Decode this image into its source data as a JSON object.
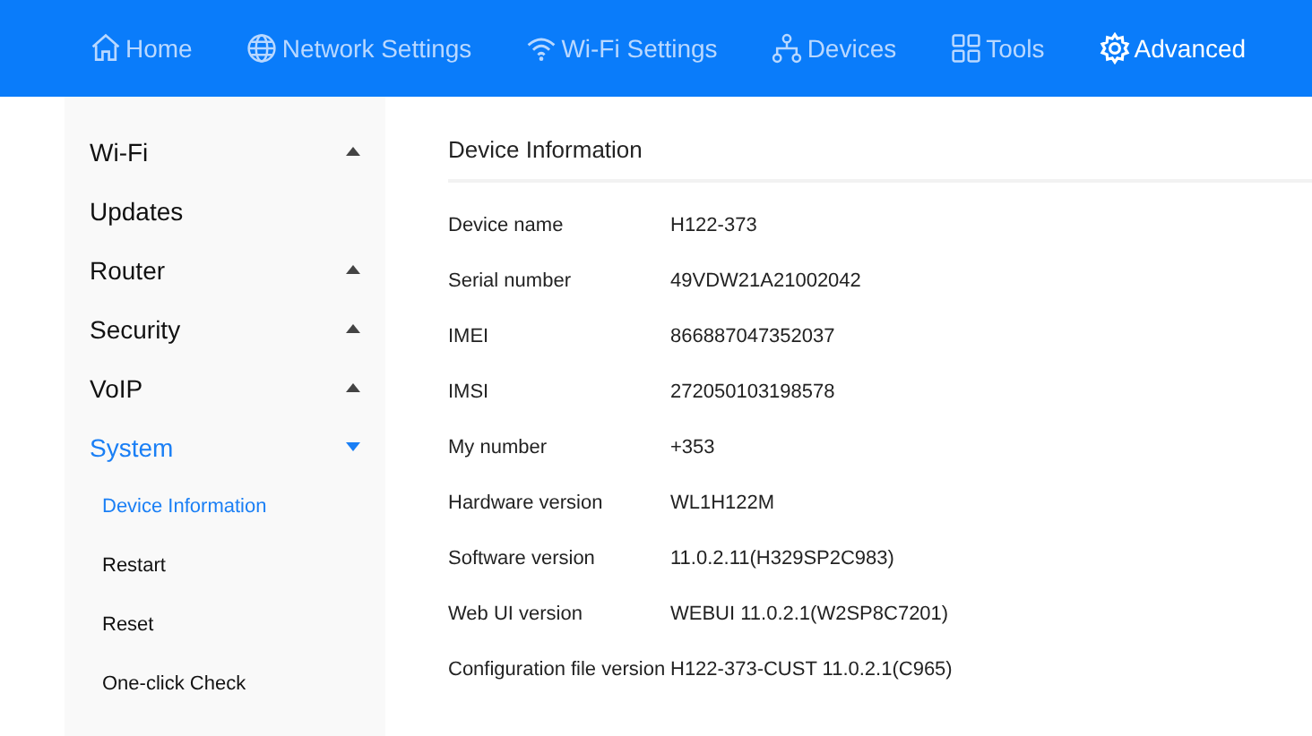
{
  "nav": [
    {
      "label": "Home",
      "kind": "home",
      "selected": false
    },
    {
      "label": "Network Settings",
      "kind": "globe",
      "selected": false
    },
    {
      "label": "Wi-Fi Settings",
      "kind": "wifi",
      "selected": false
    },
    {
      "label": "Devices",
      "kind": "devices",
      "selected": false
    },
    {
      "label": "Tools",
      "kind": "tools",
      "selected": false
    },
    {
      "label": "Advanced",
      "kind": "gear",
      "selected": true
    }
  ],
  "sidebar": {
    "items": [
      {
        "label": "Wi-Fi",
        "expanded": false,
        "selected": false
      },
      {
        "label": "Updates",
        "selected": false
      },
      {
        "label": "Router",
        "expanded": false,
        "selected": false
      },
      {
        "label": "Security",
        "expanded": false,
        "selected": false
      },
      {
        "label": "VoIP",
        "expanded": false,
        "selected": false
      },
      {
        "label": "System",
        "expanded": true,
        "selected": true,
        "children": [
          {
            "label": "Device Information",
            "selected": true
          },
          {
            "label": "Restart",
            "selected": false
          },
          {
            "label": "Reset",
            "selected": false
          },
          {
            "label": "One-click Check",
            "selected": false
          }
        ]
      }
    ]
  },
  "content": {
    "title": "Device Information",
    "rows": [
      {
        "label": "Device name",
        "value": "H122-373"
      },
      {
        "label": "Serial number",
        "value": "49VDW21A21002042"
      },
      {
        "label": "IMEI",
        "value": "866887047352037"
      },
      {
        "label": "IMSI",
        "value": "272050103198578"
      },
      {
        "label": "My number",
        "value": "+353"
      },
      {
        "label": "Hardware version",
        "value": "WL1H122M"
      },
      {
        "label": "Software version",
        "value": "11.0.2.11(H329SP2C983)"
      },
      {
        "label": "Web UI version",
        "value": "WEBUI 11.0.2.1(W2SP8C7201)"
      },
      {
        "label": "Configuration file version",
        "value": "H122-373-CUST 11.0.2.1(C965)"
      }
    ]
  }
}
